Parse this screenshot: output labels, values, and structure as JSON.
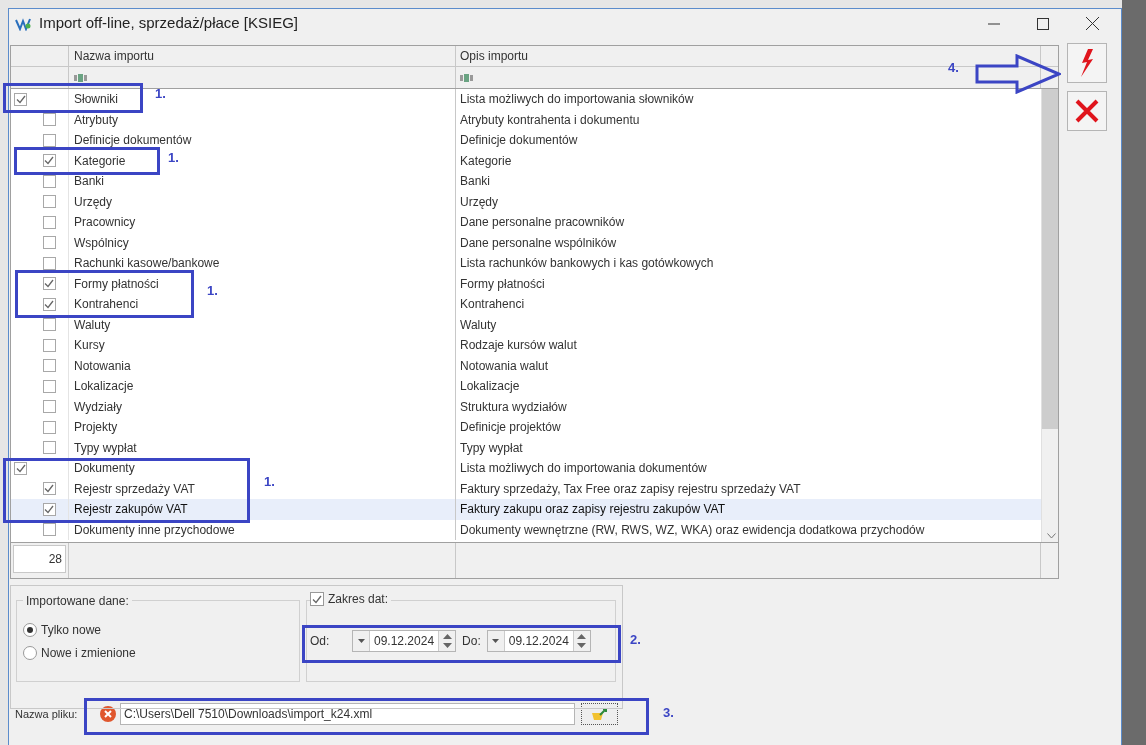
{
  "window": {
    "title": "Import off-line, sprzedaż/płace [KSIEG]"
  },
  "table": {
    "columns": [
      "Nazwa importu",
      "Opis importu"
    ],
    "rows": [
      {
        "name": "Słowniki",
        "description": "Lista możliwych do importowania słowników",
        "checked": true,
        "selected": false,
        "children": [
          {
            "name": "Atrybuty",
            "description": "Atrybuty kontrahenta i dokumentu",
            "checked": false,
            "selected": false
          },
          {
            "name": "Definicje dokumentów",
            "description": "Definicje dokumentów",
            "checked": false,
            "selected": false
          },
          {
            "name": "Kategorie",
            "description": "Kategorie",
            "checked": true,
            "selected": false
          },
          {
            "name": "Banki",
            "description": "Banki",
            "checked": false,
            "selected": false
          },
          {
            "name": "Urzędy",
            "description": "Urzędy",
            "checked": false,
            "selected": false
          },
          {
            "name": "Pracownicy",
            "description": "Dane personalne pracowników",
            "checked": false,
            "selected": false
          },
          {
            "name": "Wspólnicy",
            "description": "Dane personalne wspólników",
            "checked": false,
            "selected": false
          },
          {
            "name": "Rachunki kasowe/bankowe",
            "description": "Lista rachunków bankowych i kas gotówkowych",
            "checked": false,
            "selected": false
          },
          {
            "name": "Formy płatności",
            "description": "Formy płatności",
            "checked": true,
            "selected": false
          },
          {
            "name": "Kontrahenci",
            "description": "Kontrahenci",
            "checked": true,
            "selected": false
          },
          {
            "name": "Waluty",
            "description": "Waluty",
            "checked": false,
            "selected": false
          },
          {
            "name": "Kursy",
            "description": "Rodzaje kursów walut",
            "checked": false,
            "selected": false
          },
          {
            "name": "Notowania",
            "description": "Notowania walut",
            "checked": false,
            "selected": false
          },
          {
            "name": "Lokalizacje",
            "description": "Lokalizacje",
            "checked": false,
            "selected": false
          },
          {
            "name": "Wydziały",
            "description": "Struktura wydziałów",
            "checked": false,
            "selected": false
          },
          {
            "name": "Projekty",
            "description": "Definicje projektów",
            "checked": false,
            "selected": false
          },
          {
            "name": "Typy wypłat",
            "description": "Typy wypłat",
            "checked": false,
            "selected": false
          }
        ]
      },
      {
        "name": "Dokumenty",
        "description": "Lista możliwych do importowania dokumentów",
        "checked": true,
        "selected": false,
        "children": [
          {
            "name": "Rejestr sprzedaży VAT",
            "description": "Faktury sprzedaży, Tax Free oraz zapisy rejestru sprzedaży VAT",
            "checked": true,
            "selected": false
          },
          {
            "name": "Rejestr zakupów VAT",
            "description": "Faktury zakupu oraz zapisy rejestru zakupów VAT",
            "checked": true,
            "selected": true
          },
          {
            "name": "Dokumenty inne przychodowe",
            "description": "Dokumenty wewnętrzne (RW, RWS, WZ, WKA) oraz ewidencja dodatkowa przychodów",
            "checked": false,
            "selected": false
          }
        ]
      }
    ],
    "row_count": "28"
  },
  "imported_data": {
    "label": "Importowane dane:",
    "options": [
      {
        "label": "Tylko nowe",
        "selected": true
      },
      {
        "label": "Nowe i zmienione",
        "selected": false
      }
    ]
  },
  "date_range": {
    "label": "Zakres dat:",
    "checked": true,
    "from_label": "Od:",
    "from": "09.12.2024",
    "to_label": "Do:",
    "to": "09.12.2024"
  },
  "file": {
    "label": "Nazwa pliku:",
    "value": "C:\\Users\\Dell 7510\\Downloads\\import_k24.xml"
  },
  "annotations": [
    {
      "kind": "box",
      "label": "1."
    },
    {
      "kind": "box",
      "label": "1."
    },
    {
      "kind": "box",
      "label": "1."
    },
    {
      "kind": "box",
      "label": "1."
    },
    {
      "kind": "box",
      "label": "2."
    },
    {
      "kind": "box",
      "label": "3."
    },
    {
      "kind": "arrow",
      "label": "4."
    }
  ]
}
